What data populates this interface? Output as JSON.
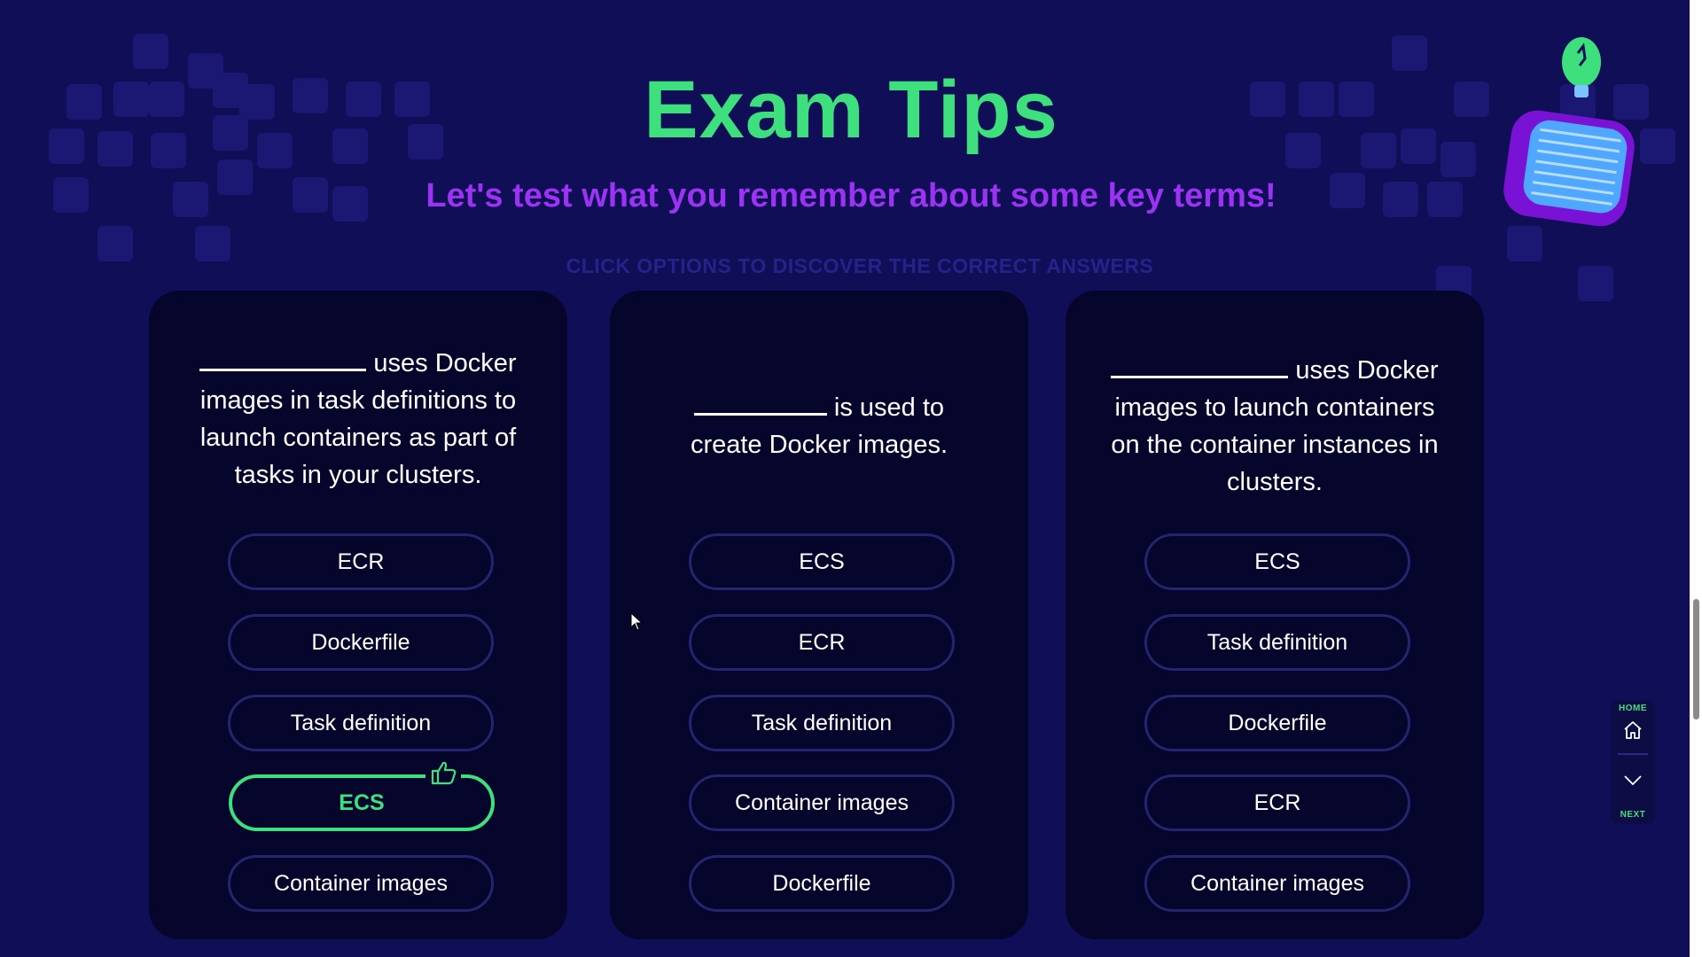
{
  "header": {
    "title": "Exam Tips",
    "subtitle": "Let's test what you remember about some key terms!",
    "hint": "CLICK OPTIONS TO DISCOVER THE CORRECT ANSWERS"
  },
  "colors": {
    "background": "#0f0e57",
    "card": "#06052c",
    "accent_green": "#3ee07d",
    "accent_purple": "#9b33f2",
    "option_border": "#26246f"
  },
  "cards": [
    {
      "question_lines": [
        "uses Docker",
        "images in task definitions to",
        "launch containers as part of",
        "tasks in your clusters."
      ],
      "options": [
        {
          "label": "ECR",
          "state": "default"
        },
        {
          "label": "Dockerfile",
          "state": "default"
        },
        {
          "label": "Task definition",
          "state": "default"
        },
        {
          "label": "ECS",
          "state": "correct",
          "icon": "thumbs-up-icon"
        },
        {
          "label": "Container images",
          "state": "default"
        }
      ]
    },
    {
      "question_lines": [
        "is used to",
        "create Docker images."
      ],
      "options": [
        {
          "label": "ECS",
          "state": "default"
        },
        {
          "label": "ECR",
          "state": "default"
        },
        {
          "label": "Task definition",
          "state": "default"
        },
        {
          "label": "Container images",
          "state": "default"
        },
        {
          "label": "Dockerfile",
          "state": "default"
        }
      ]
    },
    {
      "question_lines": [
        "uses Docker",
        "images to launch containers",
        "on the container instances in",
        "clusters."
      ],
      "options": [
        {
          "label": "ECS",
          "state": "default"
        },
        {
          "label": "Task definition",
          "state": "default"
        },
        {
          "label": "Dockerfile",
          "state": "default"
        },
        {
          "label": "ECR",
          "state": "default"
        },
        {
          "label": "Container images",
          "state": "default"
        }
      ]
    }
  ],
  "nav": {
    "home_label": "HOME",
    "next_label": "NEXT",
    "home_icon": "home-icon",
    "next_icon": "chevron-down-icon"
  }
}
